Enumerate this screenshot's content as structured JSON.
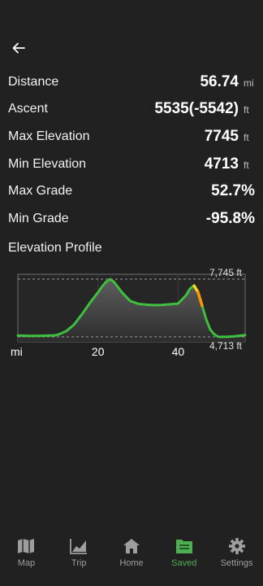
{
  "stats": [
    {
      "label": "Distance",
      "value": "56.74",
      "unit": "mi"
    },
    {
      "label": "Ascent",
      "value": "5535(-5542)",
      "unit": "ft"
    },
    {
      "label": "Max Elevation",
      "value": "7745",
      "unit": "ft"
    },
    {
      "label": "Min Elevation",
      "value": "4713",
      "unit": "ft"
    },
    {
      "label": "Max Grade",
      "value": "52.7%",
      "unit": ""
    },
    {
      "label": "Min Grade",
      "value": "-95.8%",
      "unit": ""
    }
  ],
  "profile_title": "Elevation Profile",
  "chart_data": {
    "type": "area",
    "title": "",
    "xlabel": "mi",
    "ylabel": "",
    "x_ticks": [
      20,
      40
    ],
    "xlim": [
      0,
      56.74
    ],
    "ylim": [
      4450,
      8000
    ],
    "max_label": "7,745 ft",
    "min_label": "4,713 ft",
    "max": 7745,
    "min": 4713,
    "x": [
      0,
      3,
      6,
      9,
      10,
      12,
      14,
      16,
      18,
      20,
      21,
      22,
      23,
      24,
      26,
      28,
      30,
      32,
      34,
      36,
      38,
      40,
      42,
      43,
      44,
      45,
      46,
      47,
      48,
      49,
      50,
      52,
      54,
      56.74
    ],
    "y": [
      4780,
      4760,
      4770,
      4790,
      4820,
      5000,
      5350,
      5900,
      6500,
      7050,
      7350,
      7600,
      7745,
      7600,
      7050,
      6600,
      6450,
      6400,
      6380,
      6390,
      6420,
      6460,
      6900,
      7250,
      7400,
      7050,
      6350,
      5650,
      5100,
      4850,
      4720,
      4713,
      4740,
      4800
    ]
  },
  "colors": {
    "accent": "#4caf50",
    "line": "#3fbf3f",
    "steep_up": "#ffd21a",
    "steep_down": "#ff9800",
    "background": "#212121"
  },
  "nav": [
    {
      "label": "Map",
      "icon": "map-icon",
      "active": false
    },
    {
      "label": "Trip",
      "icon": "chart-icon",
      "active": false
    },
    {
      "label": "Home",
      "icon": "home-icon",
      "active": false
    },
    {
      "label": "Saved",
      "icon": "folder-icon",
      "active": true
    },
    {
      "label": "Settings",
      "icon": "gear-icon",
      "active": false
    }
  ]
}
